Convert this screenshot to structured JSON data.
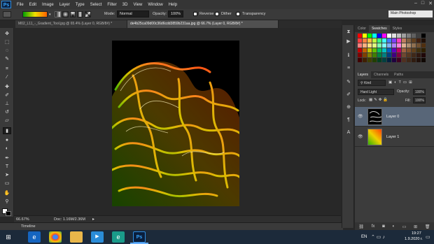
{
  "menubar": {
    "logo": "Ps",
    "items": [
      "File",
      "Edit",
      "Image",
      "Layer",
      "Type",
      "Select",
      "Filter",
      "3D",
      "View",
      "Window",
      "Help"
    ],
    "window_controls": [
      "–",
      "□",
      "✕"
    ]
  },
  "options": {
    "mode_label": "Mode:",
    "mode_value": "Normal",
    "opacity_label": "Opacity:",
    "opacity_value": "100%",
    "reverse_label": "Reverse",
    "dither_label": "Dither",
    "transparency_label": "Transparency",
    "workspace": "Main Photoshop"
  },
  "tabs": [
    {
      "label": "M02_L11_-_Gradient_Tool.jpg @ 65.4% (Layer 0, RGB/8#) *",
      "active": false
    },
    {
      "label": "de4b25ca09d00c36d6cdd3859b231aa.jpg @ 66.7% (Layer 0, RGB/8#) *",
      "active": true
    }
  ],
  "status": {
    "zoom": "66.67%",
    "doc": "Doc: 1.16M/2.36M"
  },
  "timeline_label": "Timeline",
  "panels": {
    "top_tabs": [
      "Color",
      "Swatches",
      "Styles"
    ],
    "layer_tabs": [
      "Layers",
      "Channels",
      "Paths"
    ],
    "kind_label": "Kind",
    "blend_mode": "Hard Light",
    "opacity_label": "Opacity:",
    "opacity_value": "100%",
    "lock_label": "Lock:",
    "fill_label": "Fill:",
    "fill_value": "100%",
    "layers": [
      {
        "name": "Layer 0",
        "selected": true
      },
      {
        "name": "Layer 1",
        "selected": false
      }
    ]
  },
  "taskbar": {
    "language": "EN",
    "time": "19:27",
    "date": "1.9.2020 г."
  },
  "icons": {
    "tools": [
      "move-icon",
      "marquee-icon",
      "lasso-icon",
      "quick-select-icon",
      "crop-icon",
      "eyedropper-icon",
      "healing-icon",
      "brush-icon",
      "stamp-icon",
      "history-brush-icon",
      "eraser-icon",
      "gradient-icon",
      "blur-icon",
      "dodge-icon",
      "pen-icon",
      "type-icon",
      "path-select-icon",
      "shape-icon",
      "hand-icon",
      "zoom-icon"
    ]
  },
  "colors": {
    "accent": "#2f8de0",
    "swatches": [
      "#ff0000",
      "#ffff00",
      "#00ff00",
      "#00ffff",
      "#0000ff",
      "#ff00ff",
      "#ffffff",
      "#e0e0e0",
      "#c0c0c0",
      "#a0a0a0",
      "#808080",
      "#606060",
      "#404040",
      "#000000",
      "#ff4040",
      "#ff8040",
      "#ffc040",
      "#c0ff40",
      "#40ff80",
      "#40ffff",
      "#4080ff",
      "#8040ff",
      "#ff40c0",
      "#c08060",
      "#806040",
      "#604020",
      "#402010",
      "#201008",
      "#ff8080",
      "#ffb080",
      "#ffe080",
      "#e0ff80",
      "#80ffb0",
      "#80ffff",
      "#80b0ff",
      "#b080ff",
      "#ff80e0",
      "#e0b090",
      "#b09070",
      "#907050",
      "#705030",
      "#503010",
      "#c00000",
      "#c06000",
      "#c0c000",
      "#60c000",
      "#00c060",
      "#00c0c0",
      "#0060c0",
      "#6000c0",
      "#c00060",
      "#a06040",
      "#80502a",
      "#60401c",
      "#40300e",
      "#302000",
      "#800000",
      "#804000",
      "#808000",
      "#408000",
      "#008040",
      "#008080",
      "#004080",
      "#400080",
      "#800040",
      "#704830",
      "#583820",
      "#402818",
      "#301810",
      "#200808",
      "#400000",
      "#402000",
      "#404000",
      "#204000",
      "#004020",
      "#004040",
      "#002040",
      "#200040",
      "#400020",
      "#503020",
      "#402818",
      "#301c10",
      "#20100a",
      "#100804"
    ]
  }
}
